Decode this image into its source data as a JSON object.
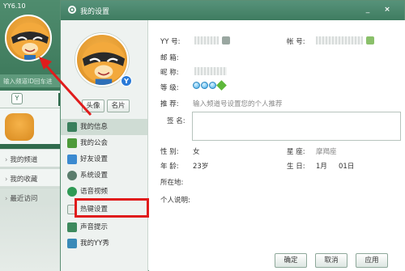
{
  "yy_main": {
    "app_title": "YY6.10",
    "search_placeholder": "输入频道ID回车进",
    "tab_icon_glyph": "Y",
    "nav": [
      {
        "label": "我的频道"
      },
      {
        "label": "我的收藏"
      },
      {
        "label": "最近访问"
      }
    ]
  },
  "dialog": {
    "title": "我的设置",
    "min_glyph": "_",
    "close_glyph": "×",
    "verified_glyph": "Y",
    "avatar_button": "头像",
    "card_button": "名片",
    "menu": [
      {
        "label": "我的信息",
        "icon": "id-card-icon",
        "color": "#3a7f5c"
      },
      {
        "label": "我的公会",
        "icon": "flag-icon",
        "color": "#4d9a3a"
      },
      {
        "label": "好友设置",
        "icon": "friends-icon",
        "color": "#3b8ad0"
      },
      {
        "label": "系统设置",
        "icon": "gear-icon",
        "color": "#5a7c6c"
      },
      {
        "label": "语音视频",
        "icon": "webcam-icon",
        "color": "#2f9a55"
      },
      {
        "label": "热键设置",
        "icon": "keyboard-icon",
        "color": "#b9c9c0"
      },
      {
        "label": "声音提示",
        "icon": "music-note-icon",
        "color": "#3e8a5e"
      },
      {
        "label": "我的YY秀",
        "icon": "shirt-icon",
        "color": "#3a8ab8"
      }
    ],
    "profile": {
      "yy_label": "YY 号:",
      "account_label": "帐 号:",
      "email_label": "邮 箱:",
      "nickname_label": "昵 称:",
      "level_label": "等 级:",
      "recommend_label": "推 荐:",
      "recommend_hint": "输入频道号设置您的个人推荐",
      "signature_label": "签 名:",
      "gender_label": "性 别:",
      "gender_value": "女",
      "zodiac_label": "星 座:",
      "zodiac_value": "摩羯座",
      "age_label": "年 龄:",
      "age_value": "23岁",
      "birthday_label": "生 日:",
      "birthday_month": "1月",
      "birthday_day": "01日",
      "location_label": "所在地:",
      "bio_label": "个人说明:",
      "level_gems": 3
    },
    "footer": {
      "ok": "确定",
      "cancel": "取消",
      "apply": "应用"
    }
  },
  "colors": {
    "accent_green": "#3f7c60",
    "annotation_red": "#e01c1c",
    "gem_blue": "#36a6e6"
  }
}
